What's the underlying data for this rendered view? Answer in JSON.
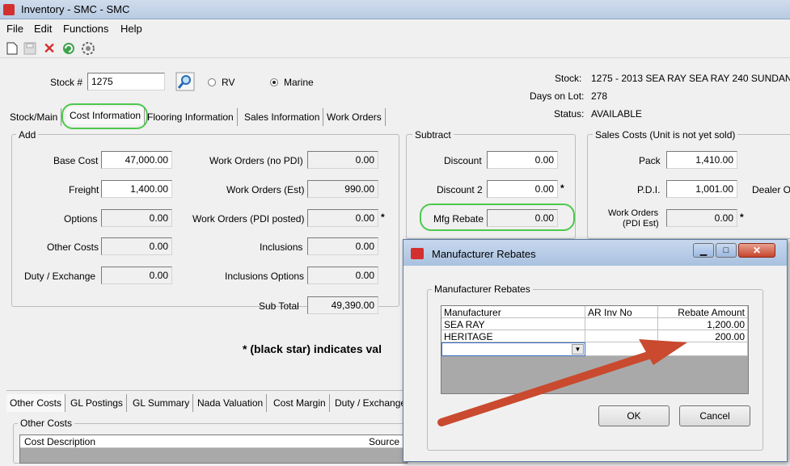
{
  "window": {
    "title": "Inventory - SMC - SMC"
  },
  "menu": [
    "File",
    "Edit",
    "Functions",
    "Help"
  ],
  "toolbar": {
    "icons": [
      "new-icon",
      "save-icon",
      "delete-icon",
      "refresh-icon",
      "settings-icon"
    ]
  },
  "stock": {
    "label": "Stock #",
    "value": "1275",
    "type_rv": "RV",
    "type_marine": "Marine",
    "selected_type": "Marine"
  },
  "info": {
    "stock_label": "Stock:",
    "stock_value": "1275 - 2013 SEA RAY SEA RAY 240 SUNDAN",
    "days_label": "Days on Lot:",
    "days_value": "278",
    "status_label": "Status:",
    "status_value": "AVAILABLE"
  },
  "tabs": [
    "Stock/Main",
    "Cost Information",
    "Flooring Information",
    "Sales Information",
    "Work Orders"
  ],
  "add": {
    "title": "Add",
    "base_cost_label": "Base Cost",
    "base_cost": "47,000.00",
    "freight_label": "Freight",
    "freight": "1,400.00",
    "options_label": "Options",
    "options": "0.00",
    "other_costs_label": "Other Costs",
    "other_costs": "0.00",
    "duty_label": "Duty / Exchange",
    "duty": "0.00",
    "wo_no_pdi_label": "Work Orders (no PDI)",
    "wo_no_pdi": "0.00",
    "wo_est_label": "Work Orders (Est)",
    "wo_est": "990.00",
    "wo_pdi_label": "Work Orders (PDI posted)",
    "wo_pdi": "0.00",
    "inclusions_label": "Inclusions",
    "inclusions": "0.00",
    "incl_options_label": "Inclusions Options",
    "incl_options": "0.00",
    "subtotal_label": "Sub Total",
    "subtotal": "49,390.00"
  },
  "subtract": {
    "title": "Subtract",
    "discount_label": "Discount",
    "discount": "0.00",
    "discount2_label": "Discount 2",
    "discount2": "0.00",
    "mfg_rebate_label": "Mfg Rebate",
    "mfg_rebate": "0.00"
  },
  "sales_costs": {
    "title": "Sales Costs (Unit is not yet sold)",
    "pack_label": "Pack",
    "pack": "1,410.00",
    "pdi_label": "P.D.I.",
    "pdi": "1,001.00",
    "dealer_label": "Dealer O",
    "wo_label_1": "Work Orders",
    "wo_label_2": "(PDI Est)",
    "wo": "0.00"
  },
  "note": "* (black star) indicates val",
  "star": "*",
  "bottom_tabs": [
    "Other Costs",
    "GL Postings",
    "GL Summary",
    "Nada Valuation",
    "Cost Margin",
    "Duty / Exchange"
  ],
  "other_costs": {
    "title": "Other Costs",
    "col_description": "Cost Description",
    "col_source": "Source"
  },
  "dialog": {
    "title": "Manufacturer Rebates",
    "group_title": "Manufacturer Rebates",
    "columns": [
      "Manufacturer",
      "AR Inv No",
      "Rebate Amount"
    ],
    "rows": [
      {
        "manufacturer": "SEA RAY",
        "ar_inv_no": "",
        "amount": "1,200.00"
      },
      {
        "manufacturer": "HERITAGE",
        "ar_inv_no": "",
        "amount": "200.00"
      }
    ],
    "ok_label": "OK",
    "cancel_label": "Cancel"
  },
  "colors": {
    "highlight": "#4cc94c",
    "arrow": "#c94a2e"
  }
}
